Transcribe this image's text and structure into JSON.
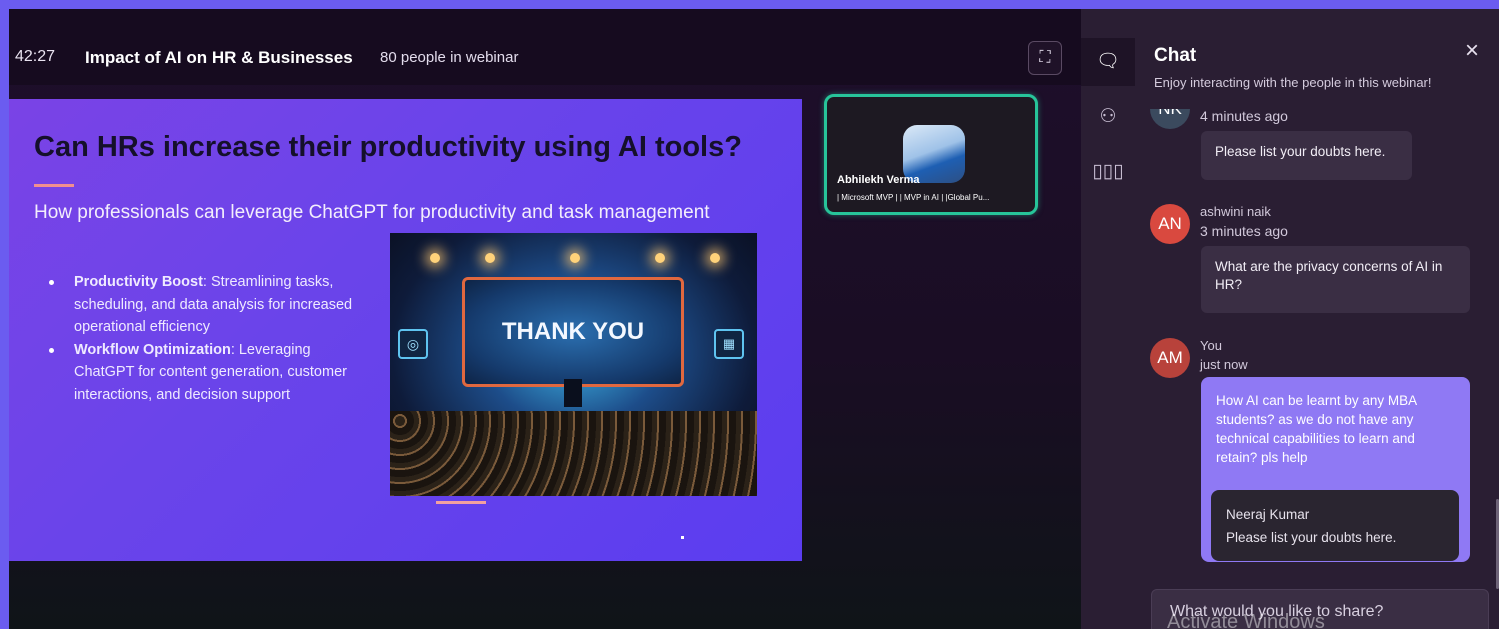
{
  "header": {
    "timer": "42:27",
    "title": "Impact of AI on HR & Businesses",
    "people_count": "80 people in webinar",
    "fullscreen_icon": "expand-icon"
  },
  "slide": {
    "title": "Can HRs increase their productivity using AI tools?",
    "subtitle": "How professionals can leverage ChatGPT for productivity and task management",
    "bullets": [
      {
        "bold": "Productivity Boost",
        "text": ": Streamlining tasks, scheduling, and data analysis for increased operational efficiency"
      },
      {
        "bold": "Workflow Optimization",
        "text": ": Leveraging ChatGPT for content generation, customer interactions, and decision support"
      }
    ],
    "image_text": "THANK YOU"
  },
  "speaker": {
    "name": "Abhilekh Verma",
    "tags": "| Microsoft MVP | | MVP in AI | |Global Pu..."
  },
  "iconbar": {
    "items": [
      "chat-icon",
      "people-icon",
      "poll-icon"
    ]
  },
  "chat": {
    "title": "Chat",
    "subtitle": "Enjoy interacting with the people in this webinar!",
    "close_icon": "×",
    "messages": [
      {
        "initials": "NK",
        "sender": "",
        "time": "4 minutes ago",
        "text": "Please list your doubts here."
      },
      {
        "initials": "AN",
        "sender": "ashwini naik",
        "time": "3 minutes ago",
        "text": "What are the privacy concerns of AI in HR?"
      },
      {
        "initials": "AM",
        "sender": "You",
        "time": "just now",
        "text": "How AI can be learnt by any MBA students? as we do not have any technical capabilities to learn and retain? pls help",
        "reply": {
          "name": "Neeraj Kumar",
          "text": "Please list your doubts here."
        }
      }
    ],
    "input_placeholder": "What would you like to share?"
  },
  "watermark": "Activate Windows",
  "colors": {
    "frame_border": "#6b5cf0",
    "slide_bg": "#6a44ea",
    "speaker_border": "#27c49a",
    "my_bubble": "#8f79f4",
    "chat_panel": "#2a1e33"
  }
}
